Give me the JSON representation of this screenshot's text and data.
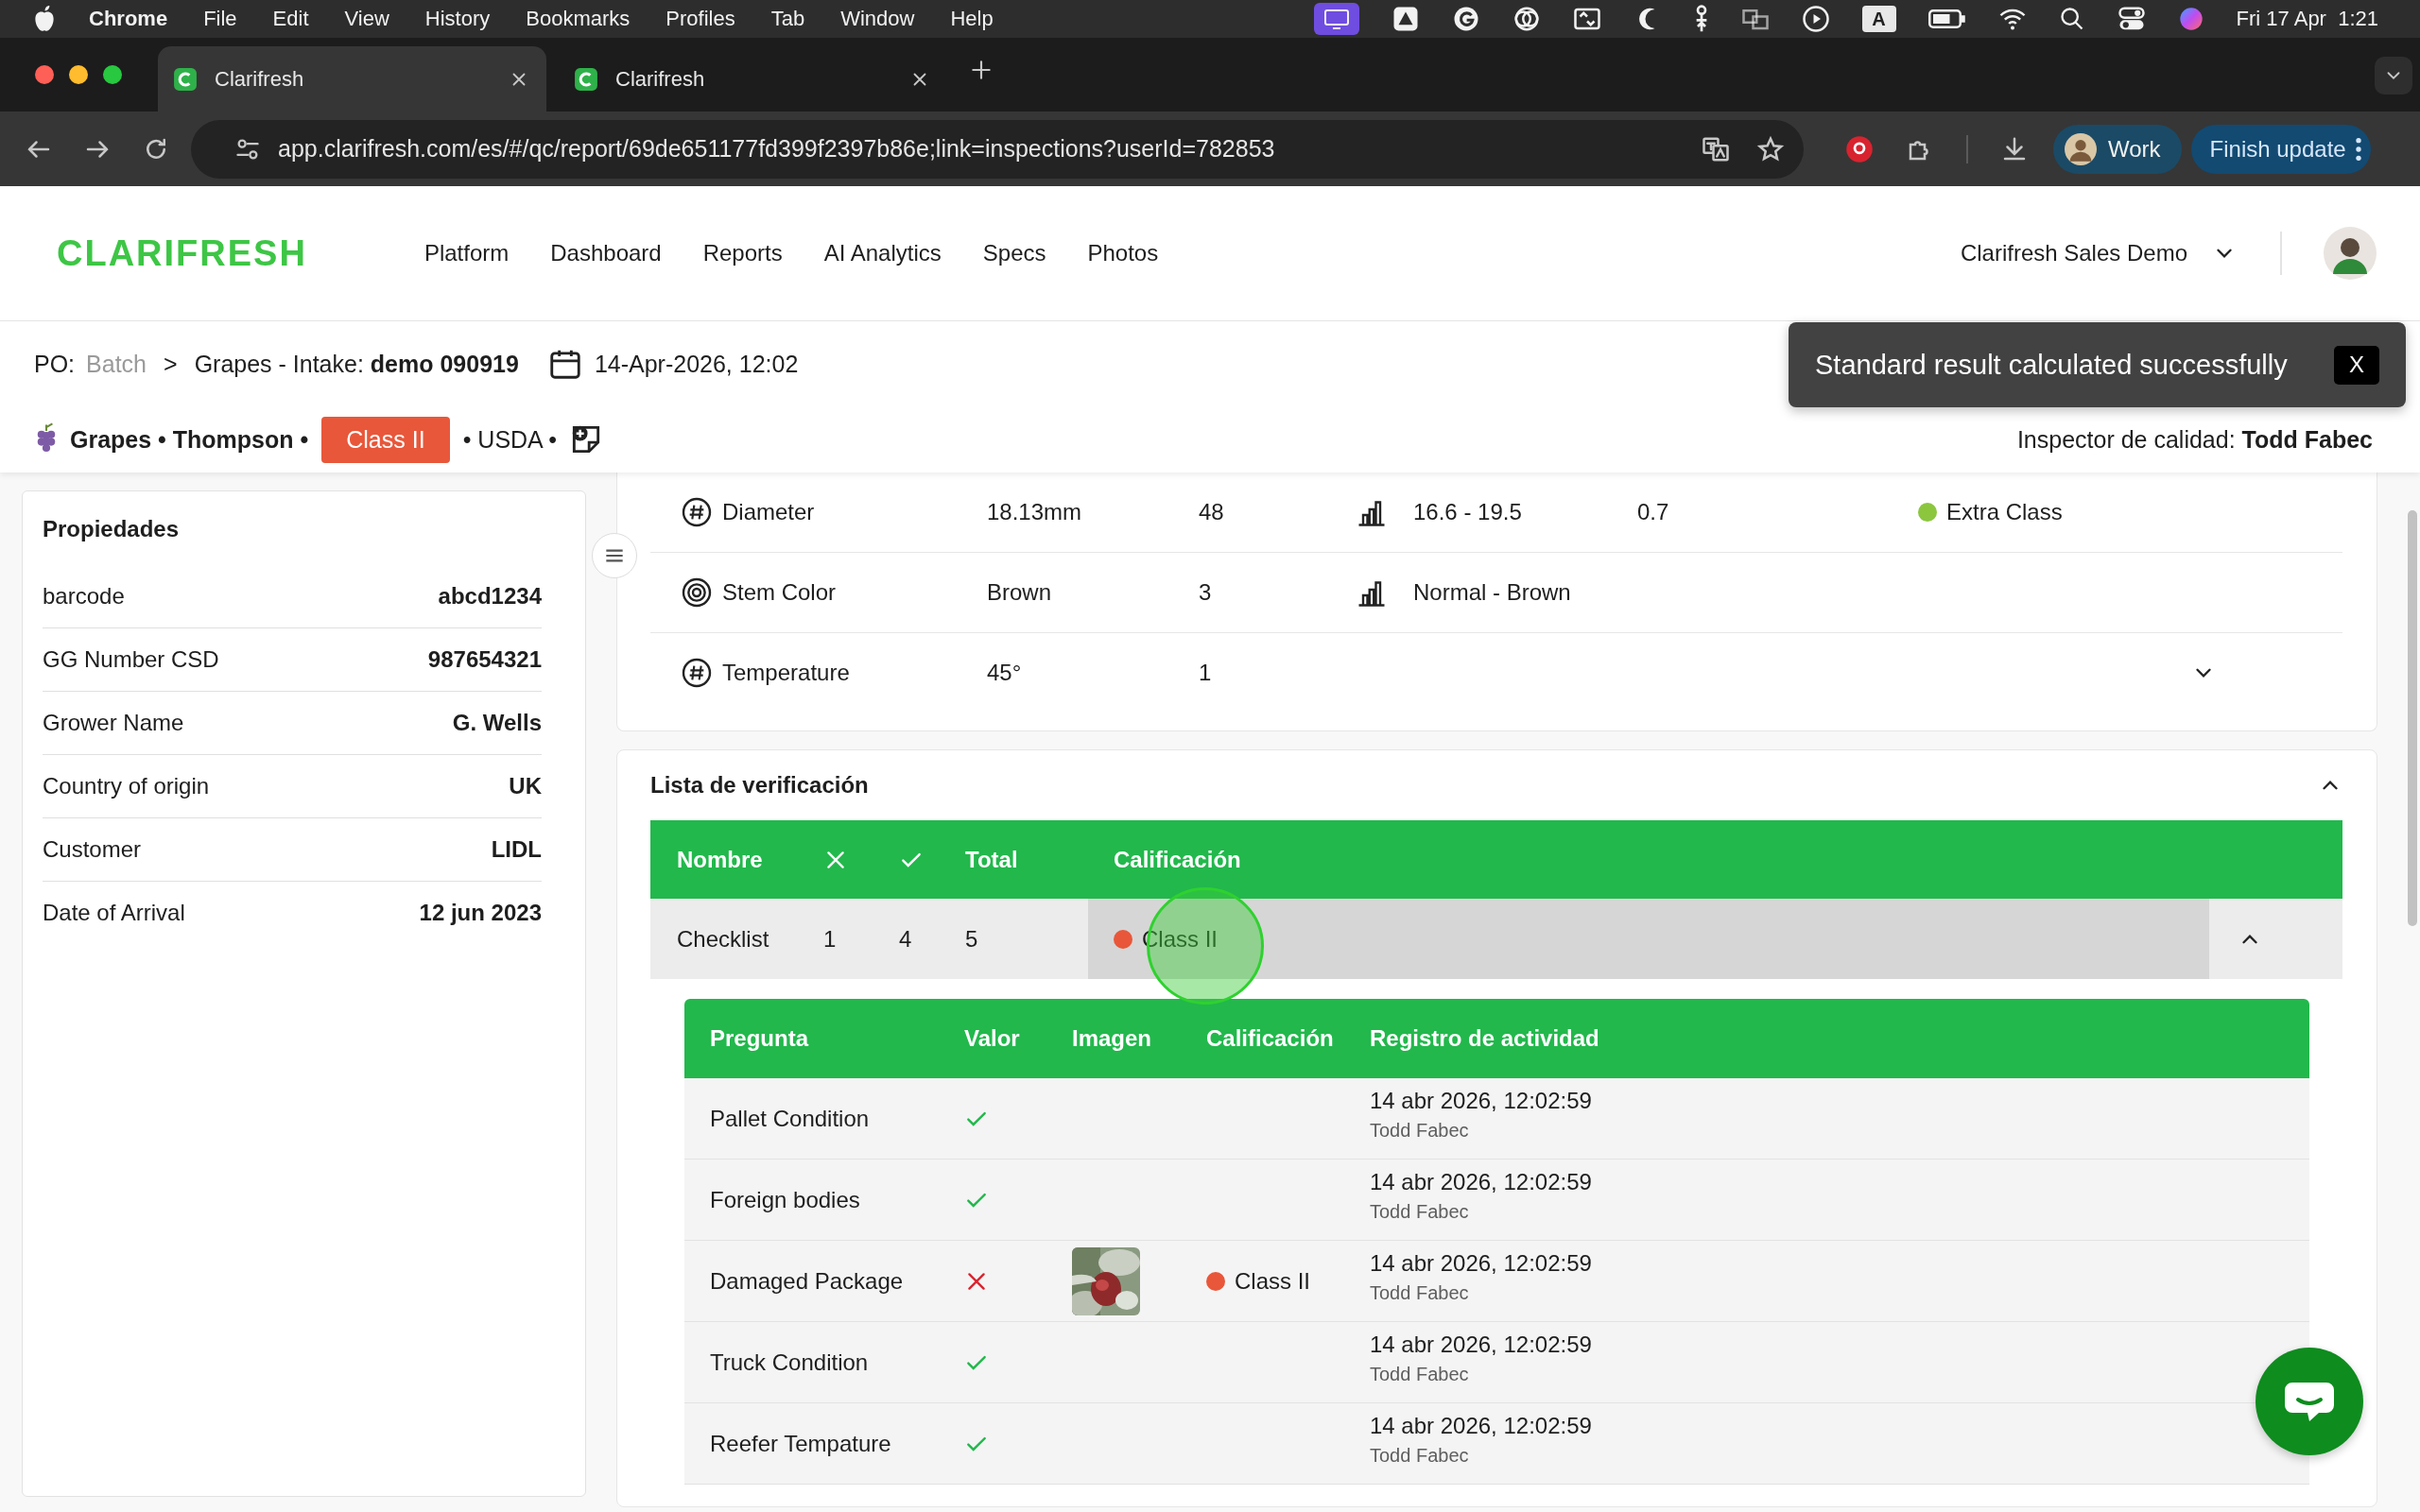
{
  "menu_bar": {
    "app": "Chrome",
    "menus": [
      "File",
      "Edit",
      "View",
      "History",
      "Bookmarks",
      "Profiles",
      "Tab",
      "Window",
      "Help"
    ],
    "input_source": "A",
    "clock": "Fri 17 Apr  1:21"
  },
  "browser": {
    "tabs": [
      {
        "title": "Clarifresh",
        "selected": true
      },
      {
        "title": "Clarifresh",
        "selected": false
      }
    ],
    "url": "app.clarifresh.com/es/#/qc/report/69de651177fd399f2397b86e;link=inspections?userId=782853",
    "profile": "Work",
    "update_button": "Finish update"
  },
  "header": {
    "logo": "CLARIFRESH",
    "nav": [
      "Platform",
      "Dashboard",
      "Reports",
      "AI Analytics",
      "Specs",
      "Photos"
    ],
    "organization": "Clarifresh Sales Demo"
  },
  "inspection": {
    "po_label": "PO:",
    "batch": "Batch",
    "separator": ">",
    "title": "Grapes - Intake: **demo 090919**",
    "date": "14-Apr-2026, 12:02",
    "product": "Grapes • Thompson •",
    "grade": {
      "text": "Class II",
      "color": "#e8573a"
    },
    "standard": "• USDA •",
    "inspector": "Inspector de calidad: **Todd Fabec**"
  },
  "properties": {
    "title": "Propiedades",
    "rows": [
      {
        "label": "barcode",
        "value": "abcd1234"
      },
      {
        "label": "GG Number CSD",
        "value": "987654321"
      },
      {
        "label": "Grower Name",
        "value": "G. Wells"
      },
      {
        "label": "Country of origin",
        "value": "UK"
      },
      {
        "label": "Customer",
        "value": "LIDL"
      },
      {
        "label": "Date of Arrival",
        "value": "12 jun 2023"
      }
    ]
  },
  "attributes": [
    {
      "kind": "number",
      "name": "Diameter",
      "value": "18.13mm",
      "count": "48",
      "range": "16.6 - 19.5",
      "deviation": "0.7",
      "grade": {
        "text": "Extra Class",
        "color": "#8cc63f"
      },
      "has_details": false
    },
    {
      "kind": "color",
      "name": "Stem Color",
      "value": "Brown",
      "count": "3",
      "range": "Normal - Brown",
      "has_details": false
    },
    {
      "kind": "number",
      "name": "Temperature",
      "value": "45°",
      "count": "1",
      "has_details": true
    }
  ],
  "checklist": {
    "title": "Lista de verificación",
    "expanded": true,
    "columns": [
      {
        "kind": "text",
        "label": "Nombre"
      },
      {
        "kind": "fail"
      },
      {
        "kind": "pass"
      },
      {
        "kind": "text",
        "label": "Total"
      },
      {
        "kind": "text",
        "label": "Calificación"
      }
    ],
    "rows": [
      {
        "name": "Checklist",
        "failed": "1",
        "passed": "4",
        "total": "5",
        "grade": {
          "text": "Class II",
          "color": "#e8573a"
        },
        "expanded": true,
        "question_columns": [
          "Pregunta",
          "Valor",
          "Imagen",
          "Calificación",
          "Registro de actividad"
        ],
        "questions": [
          {
            "question": "Pallet Condition",
            "pass": true,
            "date": "14 abr 2026, 12:02:59",
            "user": "Todd Fabec"
          },
          {
            "question": "Foreign bodies",
            "pass": true,
            "date": "14 abr 2026, 12:02:59",
            "user": "Todd Fabec"
          },
          {
            "question": "Damaged Package",
            "pass": false,
            "grade": {
              "text": "Class II",
              "color": "#e8573a"
            },
            "date": "14 abr 2026, 12:02:59",
            "user": "Todd Fabec"
          },
          {
            "question": "Truck Condition",
            "pass": true,
            "date": "14 abr 2026, 12:02:59",
            "user": "Todd Fabec"
          },
          {
            "question": "Reefer Tempature",
            "pass": true,
            "date": "14 abr 2026, 12:02:59",
            "user": "Todd Fabec"
          }
        ]
      }
    ]
  },
  "toast": {
    "message": "Standard result calculated successfully",
    "close": "X"
  }
}
